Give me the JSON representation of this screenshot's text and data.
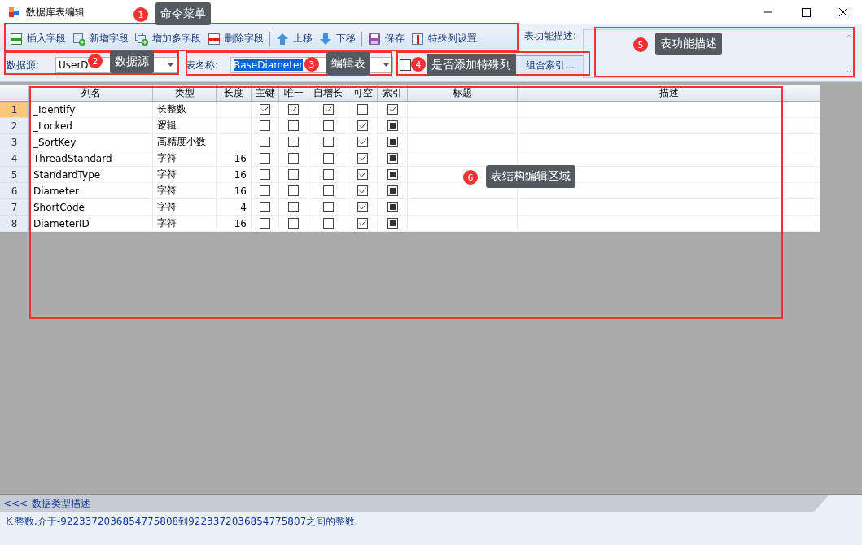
{
  "window": {
    "title": "数据库表编辑"
  },
  "toolbar": [
    {
      "label": "插入字段",
      "kind": "insert"
    },
    {
      "label": "新增字段",
      "kind": "add"
    },
    {
      "label": "增加多字段",
      "kind": "addmany"
    },
    {
      "label": "删除字段",
      "kind": "delete"
    },
    {
      "label": "上移",
      "kind": "up"
    },
    {
      "label": "下移",
      "kind": "down"
    },
    {
      "label": "保存",
      "kind": "save"
    },
    {
      "label": "特殊列设置",
      "kind": "special"
    }
  ],
  "description_label": "表功能描述:",
  "datasource": {
    "label": "数据源:",
    "value": "UserD"
  },
  "table_name": {
    "label": "表名称:",
    "value": "BaseDiameter"
  },
  "auto_special": {
    "checked": false
  },
  "combine_index_button": "组合索引...",
  "grid": {
    "columns": [
      "列名",
      "类型",
      "长度",
      "主键",
      "唯一",
      "自增长",
      "可空",
      "索引",
      "标题",
      "描述"
    ],
    "rows": [
      {
        "num": "1",
        "name": "_Identify",
        "type": "长整数",
        "length": "",
        "pk": true,
        "unique": true,
        "auto": true,
        "nullable": false,
        "index_checked": true,
        "selected": true
      },
      {
        "num": "2",
        "name": "_Locked",
        "type": "逻辑",
        "length": "",
        "pk": false,
        "unique": false,
        "auto": false,
        "nullable": true,
        "index_checked": false,
        "selected": false
      },
      {
        "num": "3",
        "name": "_SortKey",
        "type": "高精度小数",
        "length": "",
        "pk": false,
        "unique": false,
        "auto": false,
        "nullable": true,
        "index_checked": false,
        "selected": false
      },
      {
        "num": "4",
        "name": "ThreadStandard",
        "type": "字符",
        "length": "16",
        "pk": false,
        "unique": false,
        "auto": false,
        "nullable": true,
        "index_checked": false,
        "selected": false
      },
      {
        "num": "5",
        "name": "StandardType",
        "type": "字符",
        "length": "16",
        "pk": false,
        "unique": false,
        "auto": false,
        "nullable": true,
        "index_checked": false,
        "selected": false
      },
      {
        "num": "6",
        "name": "Diameter",
        "type": "字符",
        "length": "16",
        "pk": false,
        "unique": false,
        "auto": false,
        "nullable": true,
        "index_checked": false,
        "selected": false
      },
      {
        "num": "7",
        "name": "ShortCode",
        "type": "字符",
        "length": "4",
        "pk": false,
        "unique": false,
        "auto": false,
        "nullable": true,
        "index_checked": false,
        "selected": false
      },
      {
        "num": "8",
        "name": "DiameterID",
        "type": "字符",
        "length": "16",
        "pk": false,
        "unique": false,
        "auto": false,
        "nullable": true,
        "index_checked": false,
        "selected": false
      }
    ]
  },
  "type_panel": {
    "toggle": "<<<",
    "title": "数据类型描述",
    "text": "长整数,介于-9223372036854775808到9223372036854775807之间的整数."
  },
  "annotations": [
    {
      "number": "1",
      "label": "命令菜单"
    },
    {
      "number": "2",
      "label": "数据源"
    },
    {
      "number": "3",
      "label": "编辑表"
    },
    {
      "number": "4",
      "label": "是否添加特殊列"
    },
    {
      "number": "5",
      "label": "表功能描述"
    },
    {
      "number": "6",
      "label": "表结构编辑区域"
    }
  ]
}
